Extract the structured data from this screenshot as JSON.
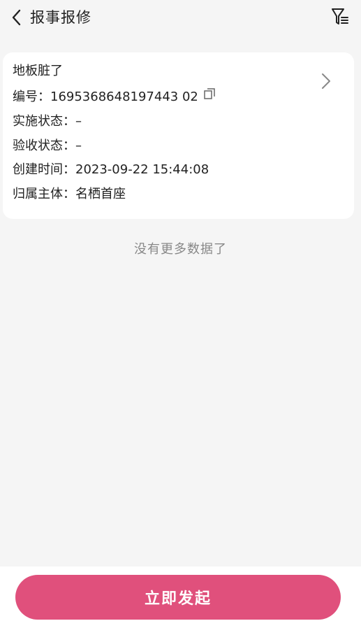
{
  "header": {
    "title": "报事报修",
    "back_icon": "chevron-left-icon",
    "filter_icon": "filter-icon"
  },
  "card": {
    "title": "地板脏了",
    "rows": [
      {
        "label": "编号：",
        "value": "1695368648197443 02"
      },
      {
        "label": "实施状态：",
        "value": "–"
      },
      {
        "label": "验收状态：",
        "value": "–"
      },
      {
        "label": "创建时间：",
        "value": "2023-09-22 15:44:08"
      },
      {
        "label": "归属主体：",
        "value": "名栖首座"
      }
    ]
  },
  "list_footer": "没有更多数据了",
  "primary_action": "立即发起",
  "colors": {
    "accent": "#e0507c",
    "background": "#f5f5f5",
    "card": "#ffffff",
    "muted": "#888888"
  }
}
